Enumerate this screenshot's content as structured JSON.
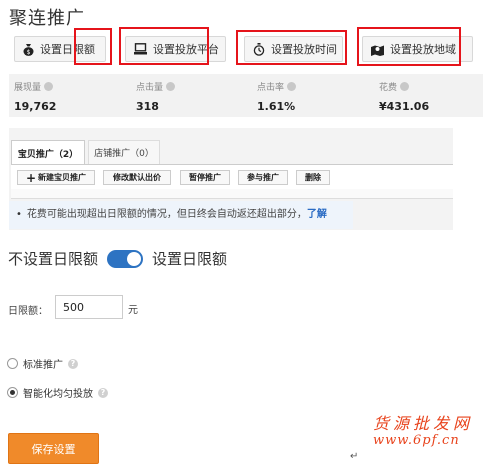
{
  "page_title": "聚连推广",
  "settings_buttons": [
    {
      "label": "设置日限额",
      "icon": "money-bag-icon"
    },
    {
      "label": "设置投放平台",
      "icon": "computer-icon"
    },
    {
      "label": "设置投放时间",
      "icon": "stopwatch-icon"
    },
    {
      "label": "设置投放地域",
      "icon": "map-pin-icon"
    }
  ],
  "stats": [
    {
      "label": "展现量",
      "value": "19,762"
    },
    {
      "label": "点击量",
      "value": "318"
    },
    {
      "label": "点击率",
      "value": "1.61%"
    },
    {
      "label": "花费",
      "value": "¥431.06"
    }
  ],
  "tabs": [
    {
      "label": "宝贝推广（2）",
      "active": true
    },
    {
      "label": "店铺推广（0）",
      "active": false
    }
  ],
  "toolbar": {
    "new_item": "新建宝贝推广",
    "edit_bid": "修改默认出价",
    "pause": "暂停推广",
    "join": "参与推广",
    "delete": "删除"
  },
  "notice": {
    "text": "花费可能出现超出日限额的情况，但日终会自动返还超出部分，",
    "link": "了解"
  },
  "budget": {
    "off_label": "不设置日限额",
    "on_label": "设置日限额",
    "toggle_on": true,
    "limit_label": "日限额：",
    "limit_value": "500",
    "unit": "元"
  },
  "delivery_modes": [
    {
      "label": "标准推广",
      "selected": false
    },
    {
      "label": "智能化均匀投放",
      "selected": true
    }
  ],
  "save_label": "保存设置",
  "watermark": {
    "name": "货源批发网",
    "url": "www.6pf.cn"
  },
  "colors": {
    "accent_blue": "#2d73c2",
    "save_orange": "#f08a2a",
    "highlight_red": "#e5141b",
    "watermark_red": "#e8431c"
  }
}
